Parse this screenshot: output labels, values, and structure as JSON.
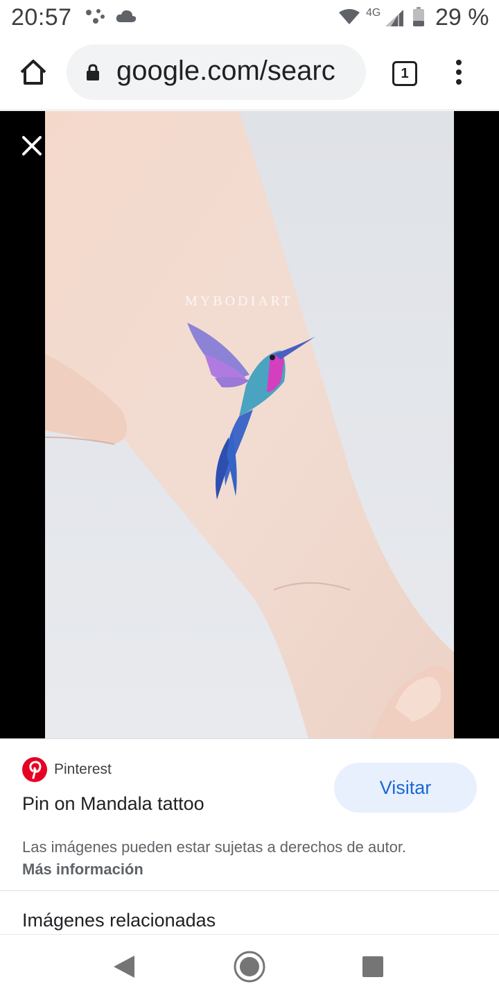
{
  "status_bar": {
    "time": "20:57",
    "network": "4G",
    "battery": "29 %"
  },
  "browser": {
    "url": "google.com/searc",
    "tab_count": "1"
  },
  "image": {
    "watermark": "MYBODIART"
  },
  "result": {
    "source": "Pinterest",
    "title": "Pin on Mandala tattoo",
    "visit_label": "Visitar",
    "copyright_text": "Las imágenes pueden estar sujetas a derechos de autor.",
    "more_info_label": "Más información",
    "related_heading": "Imágenes relacionadas"
  },
  "colors": {
    "accent_blue": "#1967d2",
    "visit_bg": "#e8f0fe",
    "pinterest_red": "#e60023"
  },
  "icons": {
    "home": "home-icon",
    "lock": "lock-icon",
    "tabs": "tab-switcher-icon",
    "menu": "more-vert-icon",
    "close": "close-icon",
    "pinterest": "pinterest-logo",
    "back": "back-icon",
    "nav_home": "circle-home-icon",
    "recents": "recents-icon"
  }
}
